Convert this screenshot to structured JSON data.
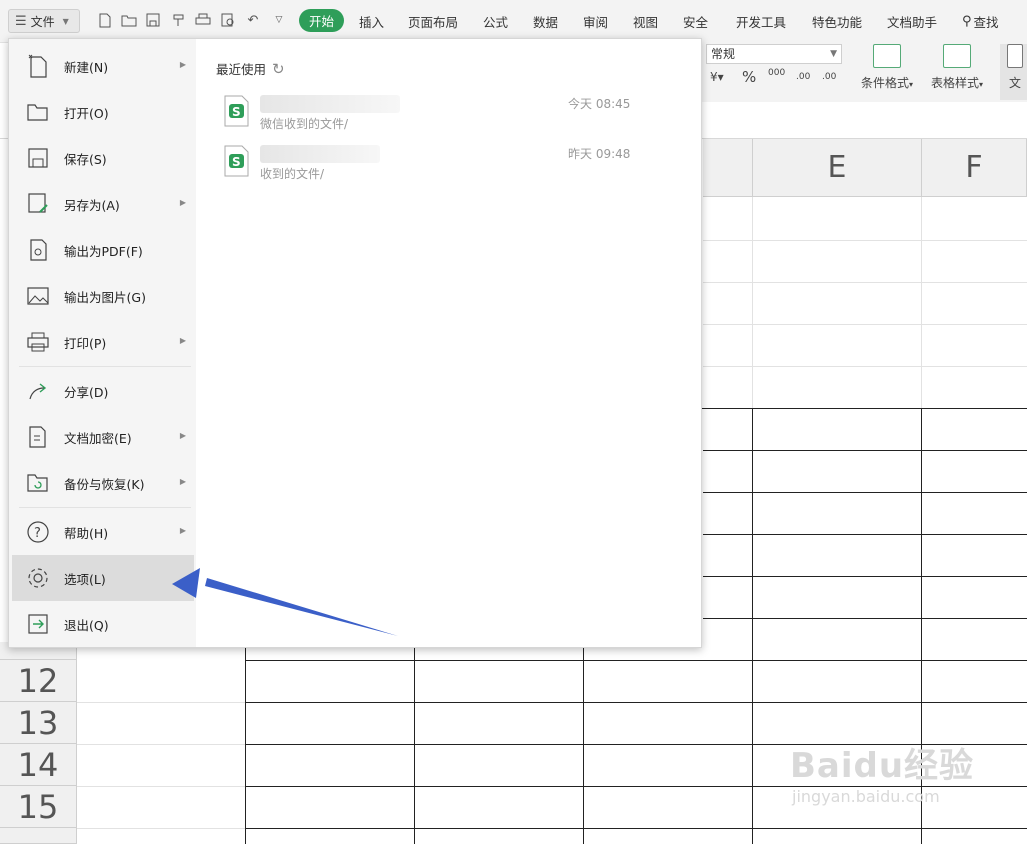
{
  "toolbar": {
    "file_label": "文件",
    "tabs": [
      {
        "label": "开始",
        "active": true
      },
      {
        "label": "插入"
      },
      {
        "label": "页面布局"
      },
      {
        "label": "公式"
      },
      {
        "label": "数据"
      },
      {
        "label": "审阅"
      },
      {
        "label": "视图"
      },
      {
        "label": "安全"
      },
      {
        "label": "开发工具"
      },
      {
        "label": "特色功能"
      },
      {
        "label": "文档助手"
      }
    ],
    "search_label": "查找"
  },
  "ribbon": {
    "number_format": "常规",
    "percent_symbol": "%",
    "thousands_symbol": "000",
    "increase_decimal": ".00",
    "decrease_decimal": ".00",
    "conditional_format": "条件格式",
    "table_style": "表格样式",
    "doc_label": "文"
  },
  "sheet": {
    "columns": [
      "E",
      "F"
    ],
    "rows": [
      "12",
      "13",
      "14",
      "15"
    ]
  },
  "file_menu": {
    "items": [
      {
        "label": "新建(N)",
        "icon": "new-file-icon",
        "submenu": true
      },
      {
        "label": "打开(O)",
        "icon": "folder-open-icon",
        "submenu": false
      },
      {
        "label": "保存(S)",
        "icon": "save-icon",
        "submenu": false
      },
      {
        "label": "另存为(A)",
        "icon": "save-as-icon",
        "submenu": true
      },
      {
        "label": "输出为PDF(F)",
        "icon": "pdf-export-icon",
        "submenu": false
      },
      {
        "label": "输出为图片(G)",
        "icon": "image-export-icon",
        "submenu": false
      },
      {
        "label": "打印(P)",
        "icon": "printer-icon",
        "submenu": true
      },
      {
        "label": "分享(D)",
        "icon": "share-icon",
        "submenu": false
      },
      {
        "label": "文档加密(E)",
        "icon": "encrypt-icon",
        "submenu": true
      },
      {
        "label": "备份与恢复(K)",
        "icon": "backup-icon",
        "submenu": true
      },
      {
        "label": "帮助(H)",
        "icon": "help-icon",
        "submenu": true
      },
      {
        "label": "选项(L)",
        "icon": "gear-icon",
        "submenu": false,
        "selected": true
      },
      {
        "label": "退出(Q)",
        "icon": "exit-icon",
        "submenu": false
      }
    ],
    "recent_title": "最近使用",
    "recent": [
      {
        "path": "微信收到的文件/",
        "time": "今天 08:45"
      },
      {
        "path": "收到的文件/",
        "time": "昨天 09:48"
      }
    ]
  },
  "watermark": {
    "brand": "Baidu经验",
    "url": "jingyan.baidu.com"
  },
  "colors": {
    "accent": "#2e9e59",
    "annotation_arrow": "#3b5fc8"
  }
}
